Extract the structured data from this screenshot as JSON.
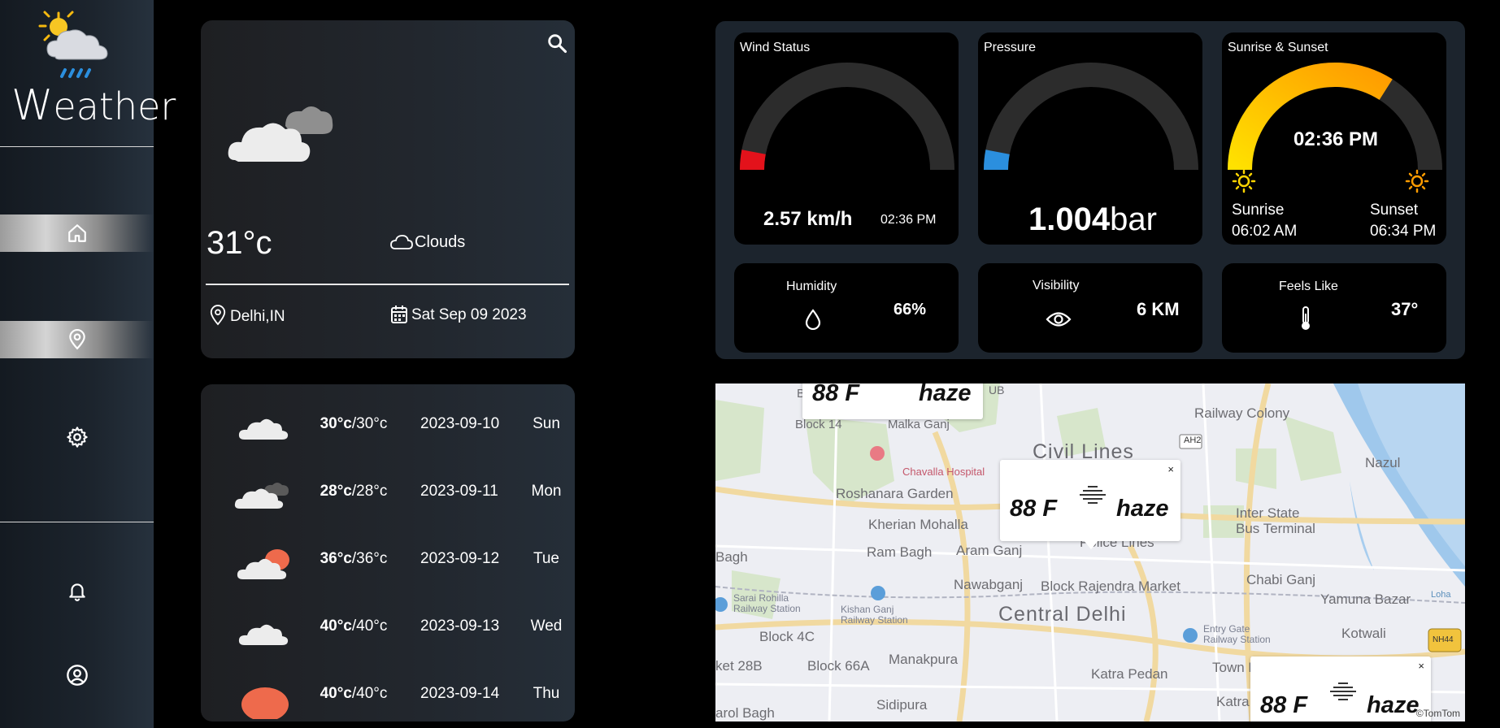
{
  "app": {
    "title": "Weather",
    "title_initial": "W",
    "title_rest": "eather"
  },
  "sidebar": {
    "items": [
      {
        "icon": "home-icon"
      },
      {
        "icon": "location-pin-icon"
      },
      {
        "icon": "gear-icon"
      },
      {
        "icon": "bell-icon"
      },
      {
        "icon": "user-circle-icon"
      }
    ]
  },
  "current": {
    "temperature": "31°c",
    "condition": "Clouds",
    "location": "Delhi,IN",
    "date": "Sat Sep 09 2023"
  },
  "forecast": [
    {
      "high": "30°c",
      "low": "/30°c",
      "date": "2023-09-10",
      "day": "Sun",
      "icon": "cloud-icon"
    },
    {
      "high": "28°c",
      "low": "/28°c",
      "date": "2023-09-11",
      "day": "Mon",
      "icon": "broken-clouds-icon"
    },
    {
      "high": "36°c",
      "low": "/36°c",
      "date": "2023-09-12",
      "day": "Tue",
      "icon": "partly-sunny-icon"
    },
    {
      "high": "40°c",
      "low": "/40°c",
      "date": "2023-09-13",
      "day": "Wed",
      "icon": "cloud-icon"
    },
    {
      "high": "40°c",
      "low": "/40°c",
      "date": "2023-09-14",
      "day": "Thu",
      "icon": "sun-icon"
    }
  ],
  "highlights": {
    "wind": {
      "label": "Wind Status",
      "value": "2.57 km/h",
      "time": "02:36 PM",
      "gauge_level": 0.06,
      "accent": "#e3121b"
    },
    "pressure": {
      "label": "Pressure",
      "value": "1.004",
      "unit": "bar",
      "gauge_level": 0.06,
      "accent": "#2b8fde"
    },
    "sun": {
      "label": "Sunrise & Sunset",
      "time": "02:36 PM",
      "sunrise_label": "Sunrise",
      "sunrise": "06:02 AM",
      "sunset_label": "Sunset",
      "sunset": "06:34 PM",
      "gauge_level": 0.68
    },
    "humidity": {
      "label": "Humidity",
      "value": "66%"
    },
    "visibility": {
      "label": "Visibility",
      "value": "6 KM"
    },
    "feels_like": {
      "label": "Feels Like",
      "value": "37°"
    }
  },
  "map": {
    "labels": {
      "civil_lines": "Civil Lines",
      "railway_colony": "Railway Colony",
      "nazul": "Nazul",
      "roshanara": "Roshanara Garden",
      "kherian": "Kherian Mohalla",
      "ram_bagh": "Ram Bagh",
      "aram_ganj": "Aram Ganj",
      "police_lines": "Police Lines",
      "isbt": "Inter State\nBus Terminal",
      "chabi_ganj": "Chabi Ganj",
      "nawabganj": "Nawabganj",
      "block_rajendra": "Block Rajendra Market",
      "yamuna_bazar": "Yamuna Bazar",
      "sarai_rohilla": "Sarai Rohilla\nRailway Station",
      "kishan_ganj": "Kishan Ganj\nRailway Station",
      "central_delhi": "Central Delhi",
      "entry_gate": "Entry Gate\nRailway Station",
      "kotwali": "Kotwali",
      "block_4c": "Block 4C",
      "manakpura": "Manakpura",
      "block_66a": "Block 66A",
      "town_hall": "Town Hall",
      "katra_pedan": "Katra Pedan",
      "katra_nawab": "Katra Nawab",
      "sidipura": "Sidipura",
      "chavalla": "Chavalla Hospital",
      "malka_ganj": "Malka Ganj",
      "block_14": "Block 14",
      "bagh": "Bagh",
      "ket_28b": "ket 28B",
      "arol_bagh": "arol Bagh",
      "ah2": "AH2",
      "nh44": "NH44",
      "b_letter": "B",
      "ub": "UB",
      "lotha": "Loha"
    },
    "popups": [
      {
        "temp": "88 F",
        "desc": "haze"
      },
      {
        "temp": "88 F",
        "desc": "haze",
        "close": "×"
      },
      {
        "temp": "88 F",
        "desc": "haze",
        "close": "×"
      }
    ],
    "attribution": "©TomTom"
  }
}
